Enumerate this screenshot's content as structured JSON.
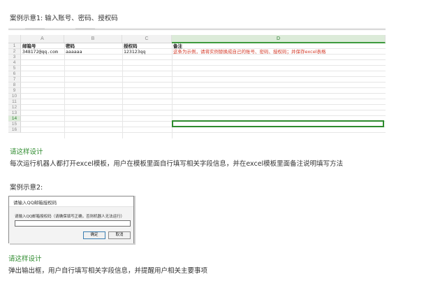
{
  "section1": {
    "caption": "案例示意1:   输入账号、密码、授权码",
    "green_heading": "请这样设计",
    "description": "每次运行机器人都打开excel模板，用户在模板里面自行填写相关字段信息，并在excel模板里面备注说明填写方法"
  },
  "spreadsheet": {
    "columns": [
      "A",
      "B",
      "C",
      "D"
    ],
    "active_column": "D",
    "rows": [
      "1",
      "2",
      "3",
      "4",
      "5",
      "6",
      "7",
      "8",
      "9",
      "10",
      "11",
      "12",
      "13",
      "14",
      "15",
      "16"
    ],
    "active_row": "14",
    "row1": {
      "a": "邮箱号",
      "b": "密码",
      "c": "授权码",
      "d": "备注"
    },
    "row2": {
      "a": "348172@qq.com",
      "b": "aaaaaa",
      "c": "123123qq",
      "d": "这条为示例，请将实例替换成自己的账号、密码、授权码；并保存excel表格"
    }
  },
  "section2": {
    "caption": "案例示意2:",
    "green_heading": "请这样设计",
    "description": "弹出输出框，用户自行填写相关字段信息，并提醒用户相关主要事项"
  },
  "dialog": {
    "title": "请输入QQ邮箱授权码",
    "prompt": "请输入QQ邮箱授权码（请确保填写正确，否则机器人无法运行）",
    "input_value": "",
    "ok_label": "确定",
    "cancel_label": "取消"
  }
}
